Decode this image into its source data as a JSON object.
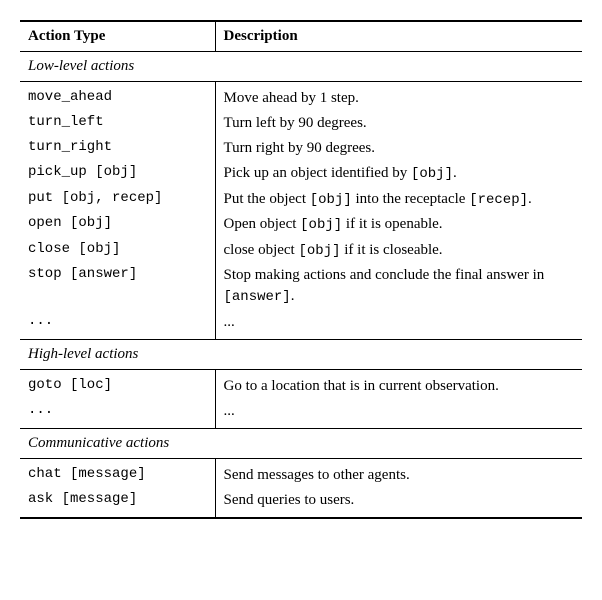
{
  "headers": {
    "action_type": "Action Type",
    "description": "Description"
  },
  "sections": [
    {
      "title": "Low-level actions",
      "rows": [
        {
          "action": "move_ahead",
          "desc": "Move ahead by 1 step."
        },
        {
          "action": "turn_left",
          "desc": "Turn left by 90 degrees."
        },
        {
          "action": "turn_right",
          "desc": "Turn right by 90 degrees."
        },
        {
          "action": "pick_up [obj]",
          "desc_pre": "Pick up an object identified by ",
          "desc_code": "[obj]",
          "desc_post": "."
        },
        {
          "action": "put [obj, recep]",
          "desc_pre": "Put the object ",
          "desc_code": "[obj]",
          "desc_mid": " into the receptacle ",
          "desc_code2": "[recep]",
          "desc_post": "."
        },
        {
          "action": "open [obj]",
          "desc_pre": "Open object ",
          "desc_code": "[obj]",
          "desc_post": " if it is openable."
        },
        {
          "action": "close [obj]",
          "desc_pre": "close object ",
          "desc_code": "[obj]",
          "desc_post": " if it is closeable."
        },
        {
          "action": "stop [answer]",
          "desc_pre": "Stop making actions and conclude the final answer in ",
          "desc_code": "[answer]",
          "desc_post": "."
        },
        {
          "action": "...",
          "desc": "..."
        }
      ]
    },
    {
      "title": "High-level actions",
      "rows": [
        {
          "action": "goto [loc]",
          "desc": "Go to a location that is in current observation."
        },
        {
          "action": "...",
          "desc": "..."
        }
      ]
    },
    {
      "title": "Communicative actions",
      "rows": [
        {
          "action": "chat [message]",
          "desc": "Send messages to other agents."
        },
        {
          "action": "ask [message]",
          "desc": "Send queries to users."
        }
      ]
    }
  ]
}
